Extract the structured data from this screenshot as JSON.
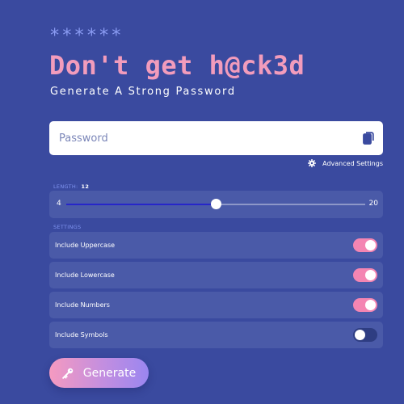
{
  "header": {
    "stars": "******",
    "title": "Don't get h@ck3d",
    "subtitle": "Generate A Strong Password"
  },
  "password": {
    "placeholder": "Password",
    "value": "",
    "copy_icon": "copy-icon"
  },
  "advanced": {
    "icon": "gear-icon",
    "label": "Advanced Settings"
  },
  "length": {
    "label": "LENGTH:",
    "value_label": "12",
    "min_label": "4",
    "max_label": "20",
    "min": 4,
    "max": 20,
    "value": 12
  },
  "settings": {
    "label": "SETTINGS",
    "items": [
      {
        "label": "Include Uppercase",
        "checked": true
      },
      {
        "label": "Include Lowercase",
        "checked": true
      },
      {
        "label": "Include Numbers",
        "checked": true
      },
      {
        "label": "Include Symbols",
        "checked": false
      }
    ]
  },
  "generate": {
    "icon": "key-icon",
    "label": "Generate"
  },
  "colors": {
    "background": "#3a4a9f",
    "panel": "#4a5aa8",
    "title": "#f29cbc",
    "accent_toggle": "#f485b2",
    "slider_fill": "#2626c9"
  }
}
